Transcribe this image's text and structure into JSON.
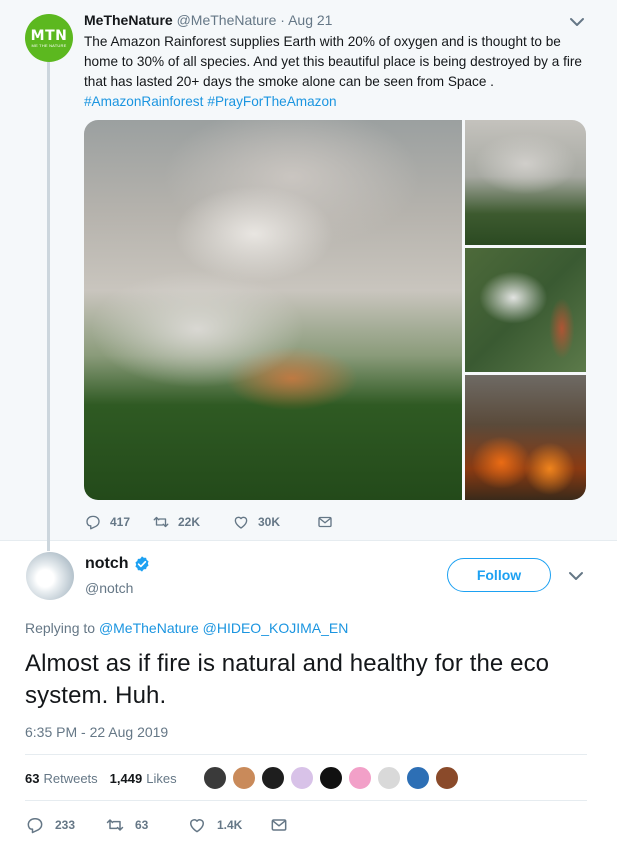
{
  "parent_tweet": {
    "name": "MeTheNature",
    "handle": "@MeTheNature",
    "separator": "·",
    "date": "Aug 21",
    "avatar_text": "MTN",
    "avatar_subtext": "ME THE NATURE",
    "text": "The Amazon Rainforest supplies Earth with 20% of oxygen and is thought to be home to 30% of all species. And yet this beautiful place is being destroyed by a fire that has lasted 20+ days the smoke alone can be seen from Space .",
    "hashtags": [
      "#AmazonRainforest",
      "#PrayForTheAmazon"
    ],
    "actions": {
      "replies": "417",
      "retweets": "22K",
      "likes": "30K"
    },
    "icons": [
      "chevron-down-icon",
      "reply-icon",
      "retweet-icon",
      "like-icon",
      "dm-icon"
    ]
  },
  "focused_tweet": {
    "name": "notch",
    "handle": "@notch",
    "verified": true,
    "follow_label": "Follow",
    "replying_prefix": "Replying to",
    "replying_to": [
      "@MeTheNature",
      "@HIDEO_KOJIMA_EN"
    ],
    "text": "Almost as if fire is natural and healthy for the eco system. Huh.",
    "timestamp": "6:35 PM - 22 Aug 2019",
    "stats": {
      "retweets_count": "63",
      "retweets_label": "Retweets",
      "likes_count": "1,449",
      "likes_label": "Likes"
    },
    "liker_colors": [
      "#3a3a3a",
      "#c98a5a",
      "#1e1e1e",
      "#d8c2e8",
      "#111111",
      "#f2a0c8",
      "#d9d9d9",
      "#2d6fb5",
      "#8a4a2a"
    ],
    "actions": {
      "replies": "233",
      "retweets": "63",
      "likes": "1.4K"
    }
  },
  "colors": {
    "accent": "#1da1f2",
    "link": "#1b95e0",
    "muted": "#657786",
    "brand_green": "#5cb81f"
  }
}
